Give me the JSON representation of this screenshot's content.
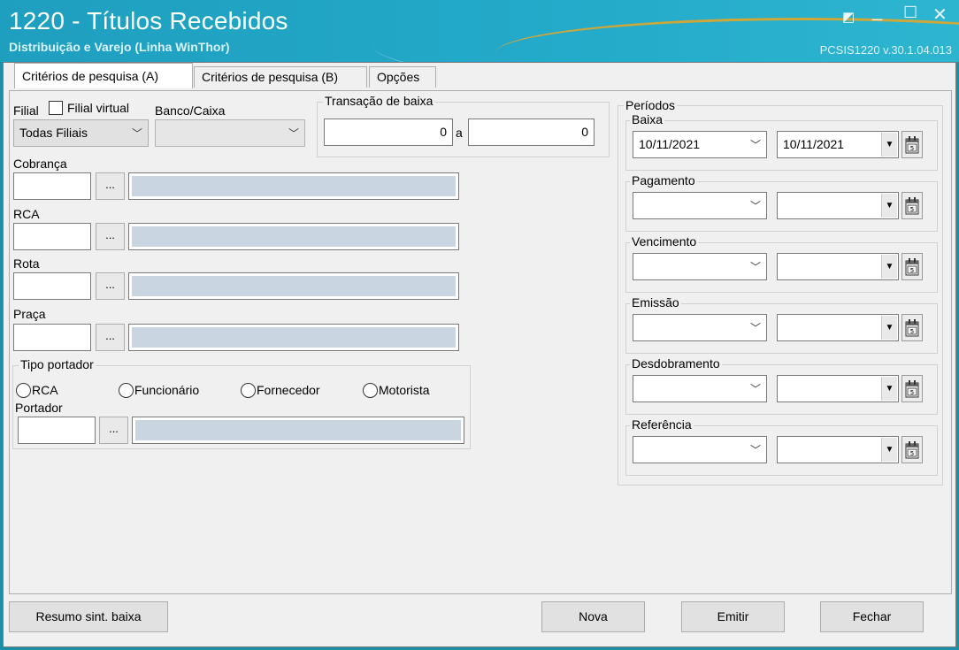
{
  "window": {
    "title": "1220 - Títulos Recebidos",
    "subtitle": "Distribuição e Varejo (Linha WinThor)",
    "version": "PCSIS1220  v.30.1.04.013",
    "controls": {
      "restore": "◩",
      "minimize": "_",
      "maximize": "☐",
      "close": "✕"
    }
  },
  "tabs": [
    {
      "label": "Critérios de pesquisa (A)",
      "active": true
    },
    {
      "label": "Critérios de pesquisa (B)",
      "active": false
    },
    {
      "label": "Opções",
      "active": false
    }
  ],
  "filters": {
    "filial_label": "Filial",
    "filial_virtual_label": "Filial virtual",
    "filial_virtual_checked": false,
    "filial_value": "Todas Filiais",
    "banco_label": "Banco/Caixa",
    "banco_value": "",
    "transacao_title": "Transação de baixa",
    "transacao_from": "0",
    "transacao_sep": "a",
    "transacao_to": "0",
    "cobranca_label": "Cobrança",
    "rca_label": "RCA",
    "rota_label": "Rota",
    "praca_label": "Praça",
    "dots": "...",
    "tipo_portador_title": "Tipo portador",
    "tipo_portador_options": [
      "RCA",
      "Funcionário",
      "Fornecedor",
      "Motorista"
    ],
    "portador_label": "Portador"
  },
  "periodos": {
    "title": "Períodos",
    "groups": [
      {
        "label": "Baixa",
        "from": "10/11/2021",
        "to": "10/11/2021"
      },
      {
        "label": "Pagamento",
        "from": "",
        "to": ""
      },
      {
        "label": "Vencimento",
        "from": "",
        "to": ""
      },
      {
        "label": "Emissão",
        "from": "",
        "to": ""
      },
      {
        "label": "Desdobramento",
        "from": "",
        "to": ""
      },
      {
        "label": "Referência",
        "from": "",
        "to": ""
      }
    ]
  },
  "buttons": {
    "resumo": "Resumo sint. baixa",
    "nova": "Nova",
    "emitir": "Emitir",
    "fechar": "Fechar"
  }
}
